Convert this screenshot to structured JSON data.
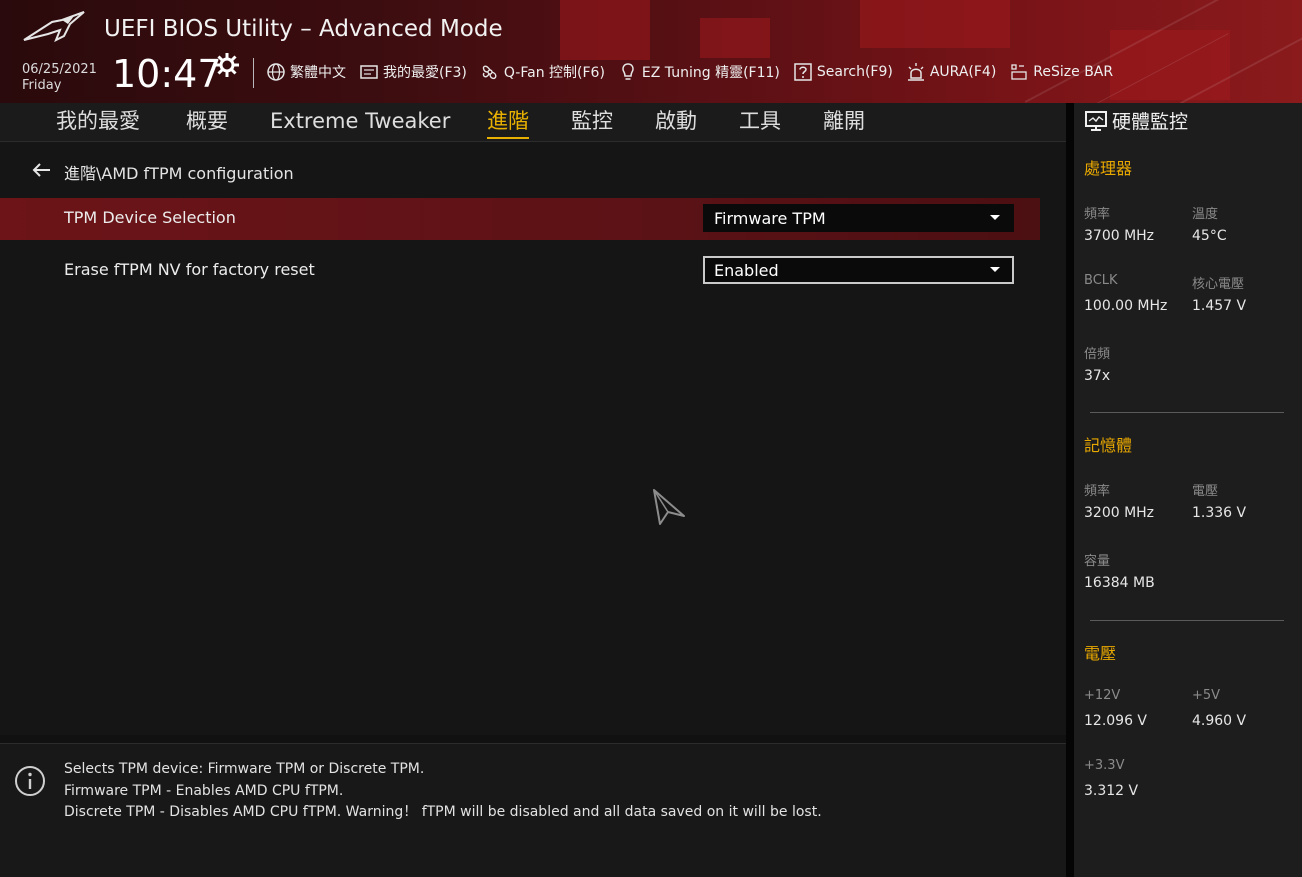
{
  "header": {
    "title": "UEFI BIOS Utility – Advanced Mode",
    "date": "06/25/2021",
    "day": "Friday",
    "time": "10:47",
    "toolbar": [
      {
        "icon": "globe-icon",
        "label": "繁體中文"
      },
      {
        "icon": "favorites-icon",
        "label": "我的最愛(F3)"
      },
      {
        "icon": "fan-icon",
        "label": "Q-Fan 控制(F6)"
      },
      {
        "icon": "lightbulb-icon",
        "label": "EZ Tuning 精靈(F11)"
      },
      {
        "icon": "question-icon",
        "label": "Search(F9)"
      },
      {
        "icon": "aura-icon",
        "label": "AURA(F4)"
      },
      {
        "icon": "resize-bar-icon",
        "label": "ReSize BAR"
      }
    ]
  },
  "tabs": [
    {
      "label": "我的最愛",
      "active": false
    },
    {
      "label": "概要",
      "active": false
    },
    {
      "label": "Extreme Tweaker",
      "active": false
    },
    {
      "label": "進階",
      "active": true
    },
    {
      "label": "監控",
      "active": false
    },
    {
      "label": "啟動",
      "active": false
    },
    {
      "label": "工具",
      "active": false
    },
    {
      "label": "離開",
      "active": false
    }
  ],
  "breadcrumb": "進階\\AMD fTPM configuration",
  "settings": [
    {
      "label": "TPM Device Selection",
      "value": "Firmware TPM",
      "selected": true
    },
    {
      "label": "Erase fTPM NV for factory reset",
      "value": "Enabled",
      "selected": false
    }
  ],
  "help": {
    "lines": [
      "Selects TPM device: Firmware TPM or Discrete TPM.",
      "Firmware TPM - Enables AMD CPU fTPM.",
      "Discrete TPM - Disables AMD CPU fTPM. Warning！ fTPM will be disabled and all data saved on it will be lost."
    ]
  },
  "monitor": {
    "title": "硬體監控",
    "cpu": {
      "title": "處理器",
      "freq_label": "頻率",
      "freq": "3700 MHz",
      "temp_label": "溫度",
      "temp": "45°C",
      "bclk_label": "BCLK",
      "bclk": "100.00 MHz",
      "vcore_label": "核心電壓",
      "vcore": "1.457 V",
      "ratio_label": "倍頻",
      "ratio": "37x"
    },
    "memory": {
      "title": "記憶體",
      "freq_label": "頻率",
      "freq": "3200 MHz",
      "volt_label": "電壓",
      "volt": "1.336 V",
      "cap_label": "容量",
      "cap": "16384 MB"
    },
    "voltage": {
      "title": "電壓",
      "v12_label": "+12V",
      "v12": "12.096 V",
      "v5_label": "+5V",
      "v5": "4.960 V",
      "v33_label": "+3.3V",
      "v33": "3.312 V"
    }
  },
  "colors": {
    "accent": "#e8b000",
    "selected_row": "#6c1418",
    "header_red": "#7a1418"
  }
}
